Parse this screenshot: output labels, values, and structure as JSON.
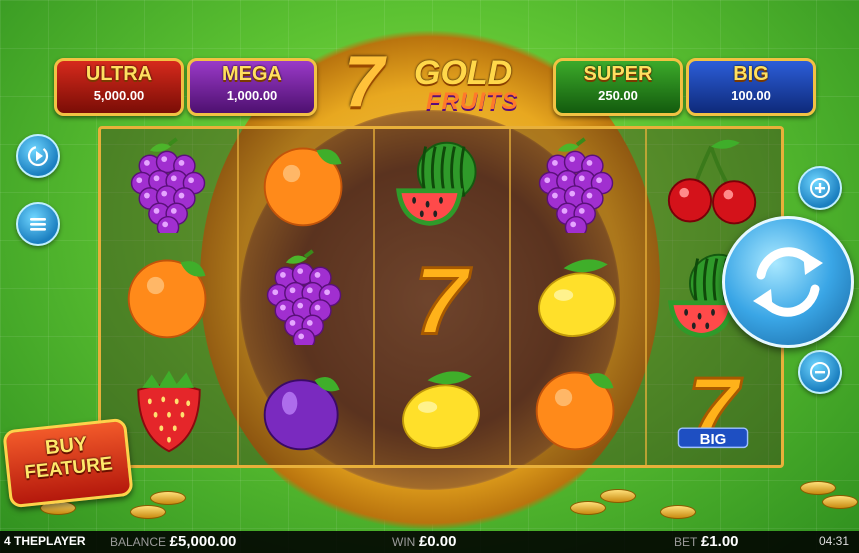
{
  "game": {
    "logo_seven": "7",
    "logo_gold": "GOLD",
    "logo_fruits": "FRUITS"
  },
  "jackpots": [
    {
      "name": "ULTRA",
      "value": "5,000.00"
    },
    {
      "name": "MEGA",
      "value": "1,000.00"
    },
    {
      "name": "SUPER",
      "value": "250.00"
    },
    {
      "name": "BIG",
      "value": "100.00"
    }
  ],
  "reels": [
    [
      "grapes",
      "orange",
      "strawberry"
    ],
    [
      "orange",
      "grapes",
      "plum"
    ],
    [
      "watermelon",
      "seven",
      "lemon"
    ],
    [
      "grapes",
      "lemon",
      "orange"
    ],
    [
      "cherries",
      "watermelon",
      "seven-big"
    ]
  ],
  "big_symbol_label": "BIG",
  "buy_feature": {
    "line1": "BUY",
    "line2": "FEATURE"
  },
  "controls": {
    "autoplay_icon": "autoplay-icon",
    "menu_icon": "menu-icon",
    "plus_icon": "plus-icon",
    "minus_icon": "minus-icon",
    "spin_icon": "spin-arrows-icon"
  },
  "status": {
    "brand": "4 THEPLAYER",
    "balance_label": "BALANCE",
    "balance_value": "£5,000.00",
    "win_label": "WIN",
    "win_value": "£0.00",
    "bet_label": "BET",
    "bet_value": "£1.00",
    "clock": "04:31"
  },
  "colors": {
    "background": "#5cc232",
    "reel_border": "#e8b03a",
    "spin_button": "#3aa6e6"
  }
}
